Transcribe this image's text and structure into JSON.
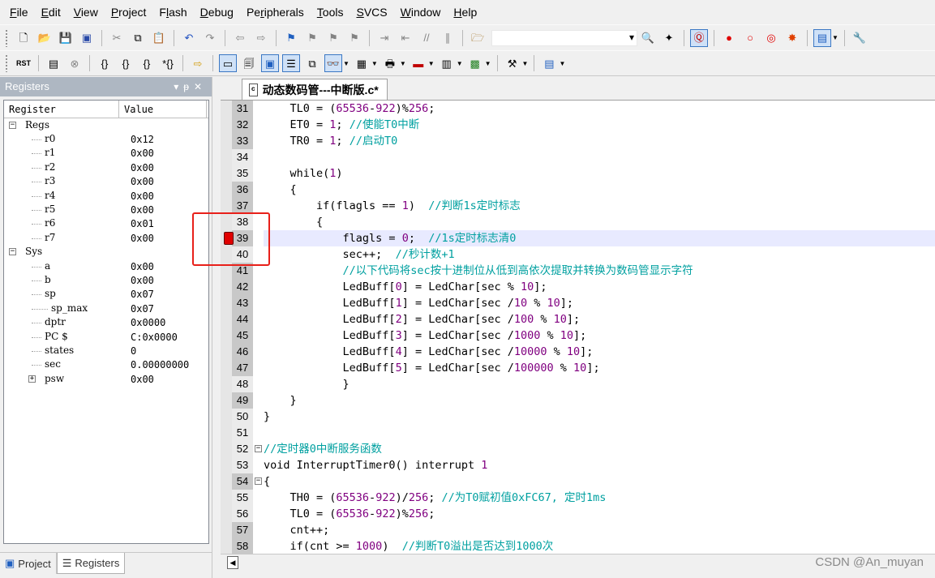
{
  "menu": [
    "File",
    "Edit",
    "View",
    "Project",
    "Flash",
    "Debug",
    "Peripherals",
    "Tools",
    "SVCS",
    "Window",
    "Help"
  ],
  "menu_underline": [
    "F",
    "E",
    "V",
    "P",
    "l",
    "D",
    "r",
    "T",
    "S",
    "W",
    "H"
  ],
  "toolbar2": {
    "rst_label": "RST"
  },
  "registers": {
    "title": "Registers",
    "col_register": "Register",
    "col_value": "Value",
    "rows": [
      {
        "name": "Regs",
        "value": "",
        "level": 0,
        "expander": "−"
      },
      {
        "name": "r0",
        "value": "0x12",
        "level": 2
      },
      {
        "name": "r1",
        "value": "0x00",
        "level": 2
      },
      {
        "name": "r2",
        "value": "0x00",
        "level": 2
      },
      {
        "name": "r3",
        "value": "0x00",
        "level": 2
      },
      {
        "name": "r4",
        "value": "0x00",
        "level": 2
      },
      {
        "name": "r5",
        "value": "0x00",
        "level": 2
      },
      {
        "name": "r6",
        "value": "0x01",
        "level": 2
      },
      {
        "name": "r7",
        "value": "0x00",
        "level": 2
      },
      {
        "name": "Sys",
        "value": "",
        "level": 0,
        "expander": "−"
      },
      {
        "name": "a",
        "value": "0x00",
        "level": 2
      },
      {
        "name": "b",
        "value": "0x00",
        "level": 2
      },
      {
        "name": "sp",
        "value": "0x07",
        "level": 2
      },
      {
        "name": "sp_max",
        "value": "0x07",
        "level": 3
      },
      {
        "name": "dptr",
        "value": "0x0000",
        "level": 2
      },
      {
        "name": "PC  $",
        "value": "C:0x0000",
        "level": 2
      },
      {
        "name": "states",
        "value": "0",
        "level": 2
      },
      {
        "name": "sec",
        "value": "0.00000000",
        "level": 2
      },
      {
        "name": "psw",
        "value": "0x00",
        "level": 2,
        "expander": "+"
      }
    ]
  },
  "panel_tabs": [
    {
      "label": "Project",
      "active": false
    },
    {
      "label": "Registers",
      "active": true
    }
  ],
  "editor": {
    "file_tab": "动态数码管---中断版.c*",
    "current_line": 39,
    "breakpoint_line": 39,
    "lines": [
      {
        "n": "31",
        "code": "    TL0 = (65536-922)%256;"
      },
      {
        "n": "32",
        "code": "    ET0 = 1; //使能T0中断"
      },
      {
        "n": "33",
        "code": "    TR0 = 1; //启动T0"
      },
      {
        "n": "34",
        "code": ""
      },
      {
        "n": "35",
        "code": "    while(1)"
      },
      {
        "n": "36",
        "code": "    {"
      },
      {
        "n": "37",
        "code": "        if(flagls == 1)  //判断1s定时标志"
      },
      {
        "n": "38",
        "code": "        {"
      },
      {
        "n": "39",
        "code": "            flagls = 0;  //1s定时标志清0"
      },
      {
        "n": "40",
        "code": "            sec++;  //秒计数+1"
      },
      {
        "n": "41",
        "code": "            //以下代码将sec按十进制位从低到高依次提取并转换为数码管显示字符"
      },
      {
        "n": "42",
        "code": "            LedBuff[0] = LedChar[sec % 10];"
      },
      {
        "n": "43",
        "code": "            LedBuff[1] = LedChar[sec /10 % 10];"
      },
      {
        "n": "44",
        "code": "            LedBuff[2] = LedChar[sec /100 % 10];"
      },
      {
        "n": "45",
        "code": "            LedBuff[3] = LedChar[sec /1000 % 10];"
      },
      {
        "n": "46",
        "code": "            LedBuff[4] = LedChar[sec /10000 % 10];"
      },
      {
        "n": "47",
        "code": "            LedBuff[5] = LedChar[sec /100000 % 10];"
      },
      {
        "n": "48",
        "code": "            }"
      },
      {
        "n": "49",
        "code": "    }"
      },
      {
        "n": "50",
        "code": "}"
      },
      {
        "n": "51",
        "code": ""
      },
      {
        "n": "52",
        "code": "//定时器0中断服务函数",
        "fold": "−"
      },
      {
        "n": "53",
        "code": "void InterruptTimer0() interrupt 1"
      },
      {
        "n": "54",
        "code": "{",
        "fold": "−"
      },
      {
        "n": "55",
        "code": "    TH0 = (65536-922)/256; //为T0赋初值0xFC67, 定时1ms"
      },
      {
        "n": "56",
        "code": "    TL0 = (65536-922)%256;"
      },
      {
        "n": "57",
        "code": "    cnt++;"
      },
      {
        "n": "58",
        "code": "    if(cnt >= 1000)  //判断T0溢出是否达到1000次"
      }
    ]
  },
  "watermark": "CSDN @An_muyan",
  "colors": {
    "breakpoint": "#e00000",
    "highlight_box": "#e8201a",
    "comment": "#00a0a0",
    "number": "#800080",
    "current_line": "#e8eaff"
  },
  "icons": [
    "new-file-icon",
    "open-folder-icon",
    "save-icon",
    "save-all-icon",
    "cut-icon",
    "copy-icon",
    "paste-icon",
    "undo-icon",
    "redo-icon",
    "nav-back-icon",
    "nav-forward-icon",
    "bookmark-icon",
    "indent-icon",
    "outdent-icon",
    "comment-icon",
    "uncomment-icon",
    "find-in-files-icon",
    "debug-icon",
    "breakpoint-icon",
    "wrench-icon"
  ]
}
